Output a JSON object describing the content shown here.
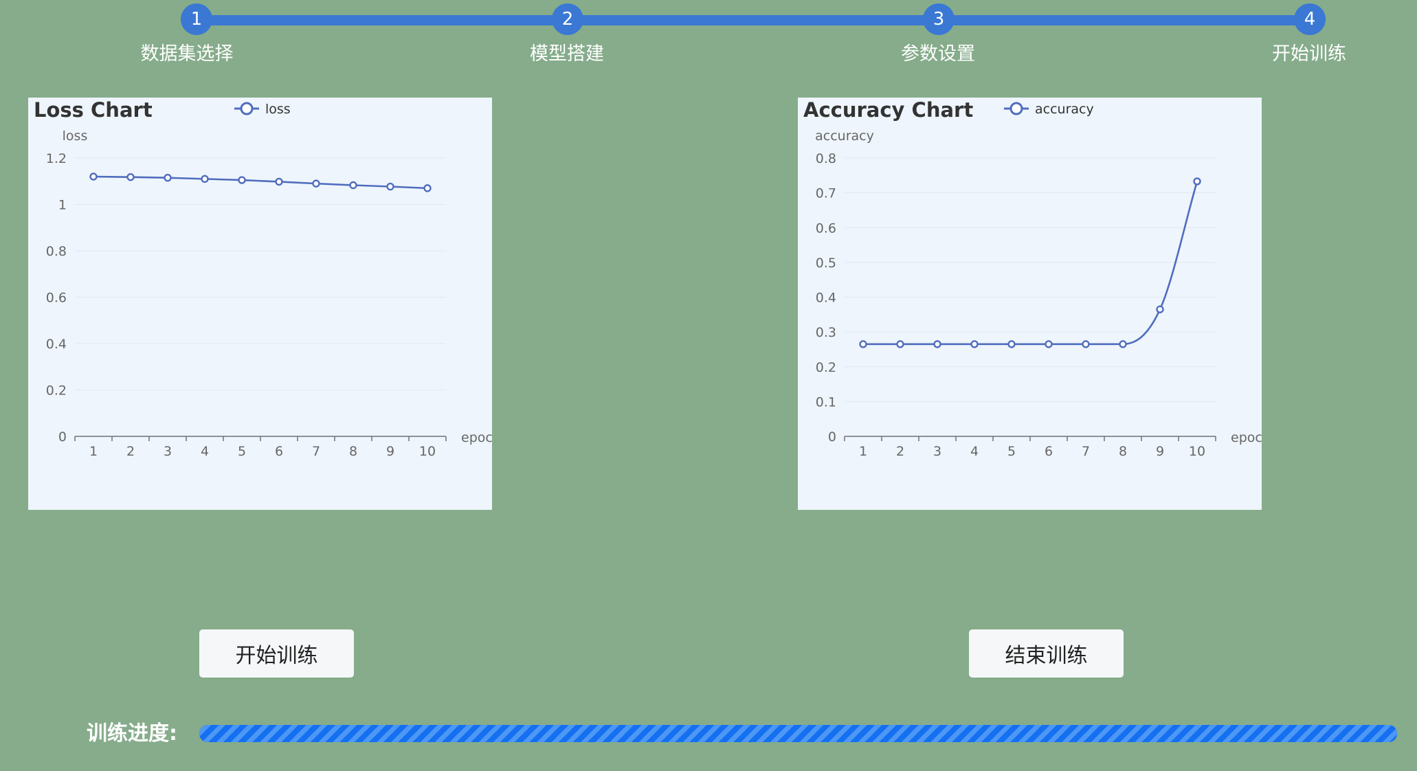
{
  "steps": [
    {
      "number": "1",
      "label": "数据集选择"
    },
    {
      "number": "2",
      "label": "模型搭建"
    },
    {
      "number": "3",
      "label": "参数设置"
    },
    {
      "number": "4",
      "label": "开始训练"
    }
  ],
  "colors": {
    "background": "#86ac8b",
    "accent": "#3a78d4",
    "chart_background": "#eef5fc",
    "series": "#4f6cbe",
    "progress": "#1470f0"
  },
  "buttons": {
    "start": "开始训练",
    "stop": "结束训练"
  },
  "progress": {
    "label": "训练进度:",
    "value": 1.0
  },
  "chart_data": [
    {
      "type": "line",
      "title": "Loss Chart",
      "legend": [
        "loss"
      ],
      "legend_position": "top",
      "xlabel": "epoch",
      "ylabel": "loss",
      "categories": [
        "1",
        "2",
        "3",
        "4",
        "5",
        "6",
        "7",
        "8",
        "9",
        "10"
      ],
      "series": [
        {
          "name": "loss",
          "values": [
            1.12,
            1.118,
            1.115,
            1.11,
            1.105,
            1.098,
            1.09,
            1.083,
            1.077,
            1.07
          ]
        }
      ],
      "ylim": [
        0,
        1.2
      ],
      "yticks": [
        "0",
        "0.2",
        "0.4",
        "0.6",
        "0.8",
        "1",
        "1.2"
      ],
      "smooth": false,
      "grid": true
    },
    {
      "type": "line",
      "title": "Accuracy Chart",
      "legend": [
        "accuracy"
      ],
      "legend_position": "top",
      "xlabel": "epoch",
      "ylabel": "accuracy",
      "categories": [
        "1",
        "2",
        "3",
        "4",
        "5",
        "6",
        "7",
        "8",
        "9",
        "10"
      ],
      "series": [
        {
          "name": "accuracy",
          "values": [
            0.265,
            0.265,
            0.265,
            0.265,
            0.265,
            0.265,
            0.265,
            0.265,
            0.365,
            0.733
          ]
        }
      ],
      "ylim": [
        0,
        0.8
      ],
      "yticks": [
        "0",
        "0.1",
        "0.2",
        "0.3",
        "0.4",
        "0.5",
        "0.6",
        "0.7",
        "0.8"
      ],
      "smooth": true,
      "grid": true
    }
  ]
}
